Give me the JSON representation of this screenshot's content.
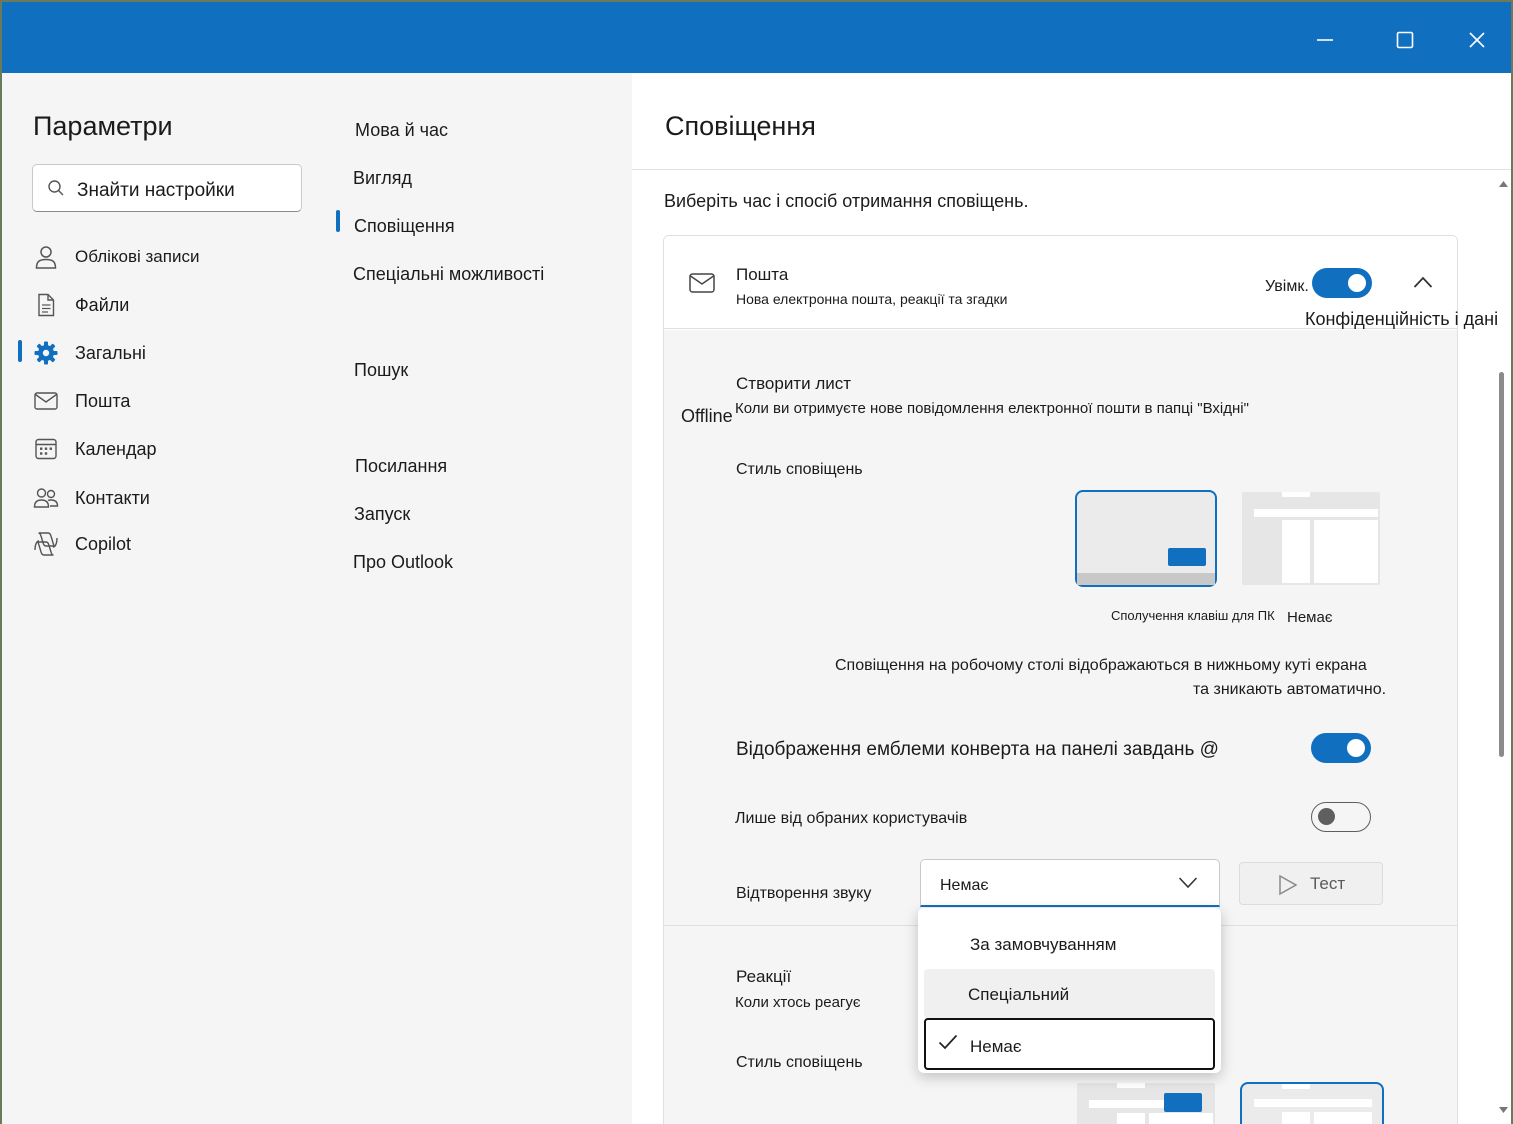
{
  "window": {
    "controls": {
      "minimize": "minimize-icon",
      "maximize": "maximize-icon",
      "close": "close-icon"
    }
  },
  "left": {
    "title": "Параметри",
    "search_value": "Знайти настройки",
    "items": [
      {
        "label": "Облікові записи",
        "icon": "person-icon"
      },
      {
        "label": "Файли",
        "icon": "file-icon"
      },
      {
        "label": "Загальні",
        "icon": "gear-icon",
        "active": true
      },
      {
        "label": "Пошта",
        "icon": "mail-icon"
      },
      {
        "label": "Календар",
        "icon": "calendar-icon"
      },
      {
        "label": "Контакти",
        "icon": "contacts-icon"
      },
      {
        "label": "Copilot",
        "icon": "copilot-icon"
      }
    ]
  },
  "middle": {
    "items": [
      {
        "label": "Мова й час"
      },
      {
        "label": "Вигляд"
      },
      {
        "label": "Сповіщення",
        "active": true
      },
      {
        "label": "Спеціальні можливості"
      },
      {
        "label": "Пошук"
      },
      {
        "label": "Посилання"
      },
      {
        "label": "Запуск"
      },
      {
        "label": "Про Outlook"
      }
    ]
  },
  "main": {
    "title": "Сповіщення",
    "intro": "Виберіть час і спосіб отримання сповіщень.",
    "overlay_labels": {
      "offline": "Offline",
      "privacy": "Конфіденційність і дані"
    },
    "mail_card": {
      "title": "Пошта",
      "subtitle": "Нова електронна пошта, реакції та згадки",
      "toggle_label": "Увімк.",
      "toggle_on": true,
      "new_mail": {
        "title": "Створити лист",
        "desc": "Коли ви отримуєте нове повідомлення електронної пошти в папці \"Вхідні\"",
        "style_label": "Стиль сповіщень",
        "style_options": [
          "Сполучення клавіш для ПК",
          "Немає"
        ],
        "style_selected": 0,
        "style_note_line1": "Сповіщення на робочому столі відображаються в нижньому куті екрана",
        "style_note_line2": "та зникають автоматично.",
        "badge_label": "Відображення емблеми конверта на панелі завдань @",
        "badge_on": true,
        "favorites_label": "Лише від обраних користувачів",
        "favorites_on": false,
        "sound_label": "Відтворення звуку",
        "sound_value": "Немає",
        "test_label": "Тест"
      },
      "reactions": {
        "title": "Реакції",
        "desc": "Коли хтось реагує",
        "style_label": "Стиль сповіщень",
        "style_selected": 1
      }
    },
    "sound_menu": {
      "options": [
        "За замовчуванням",
        "Спеціальний",
        "Немає"
      ],
      "selected": 2
    }
  },
  "colors": {
    "accent": "#116fc0",
    "titlebar": "#116fc0",
    "pane_bg": "#f5f5f5"
  }
}
